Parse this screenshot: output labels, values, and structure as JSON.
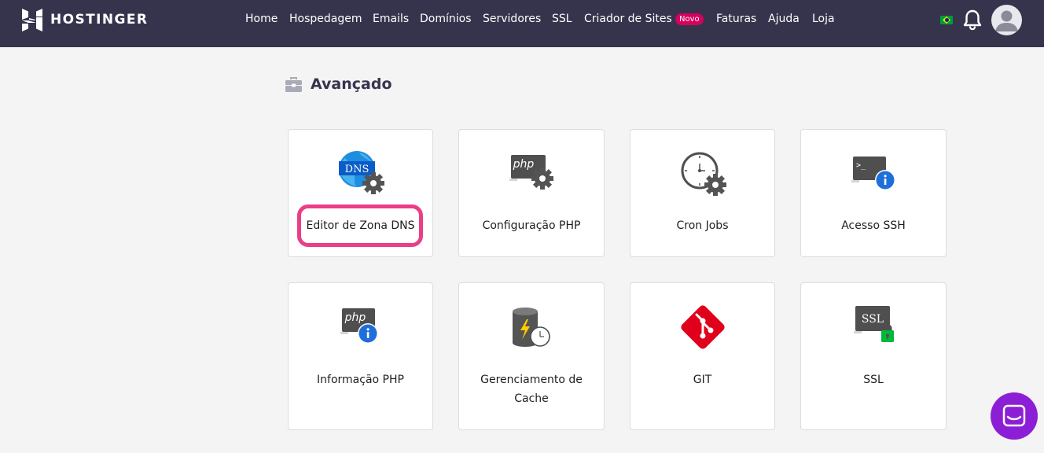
{
  "brand": {
    "name": "HOSTINGER"
  },
  "nav": {
    "items": [
      {
        "label": "Home"
      },
      {
        "label": "Hospedagem"
      },
      {
        "label": "Emails"
      },
      {
        "label": "Domínios"
      },
      {
        "label": "Servidores"
      },
      {
        "label": "SSL"
      },
      {
        "label": "Criador de Sites"
      },
      {
        "label": "Faturas"
      },
      {
        "label": "Ajuda"
      },
      {
        "label": "Loja"
      }
    ],
    "badge": "Novo"
  },
  "header": {
    "flag": "brazil-flag",
    "bell": "bell-icon",
    "avatar": "user-avatar"
  },
  "section": {
    "title": "Avançado",
    "icon": "toolbox-icon"
  },
  "cards": [
    {
      "label": "Editor de Zona DNS",
      "icon": "dns-gear-icon",
      "icon_text": "DNS"
    },
    {
      "label": "Configuração PHP",
      "icon": "php-gear-icon",
      "icon_text": "php"
    },
    {
      "label": "Cron Jobs",
      "icon": "clock-gear-icon"
    },
    {
      "label": "Acesso SSH",
      "icon": "terminal-info-icon",
      "icon_text": ">_"
    },
    {
      "label": "Informação PHP",
      "icon": "php-info-icon",
      "icon_text": "php"
    },
    {
      "label": "Gerenciamento de",
      "label2": "Cache",
      "icon": "database-clock-icon"
    },
    {
      "label": "GIT",
      "icon": "git-icon"
    },
    {
      "label": "SSL",
      "icon": "ssl-lock-icon",
      "icon_text": "SSL"
    }
  ],
  "colors": {
    "topbar": "#36344d",
    "highlight": "#ea3f86",
    "badge": "#d6005e",
    "chat": "#8c1fd6",
    "accent_blue": "#1e6fd9",
    "git_red": "#e0001b",
    "lock_green": "#00b83a"
  },
  "chat": {
    "icon": "chat-icon"
  }
}
